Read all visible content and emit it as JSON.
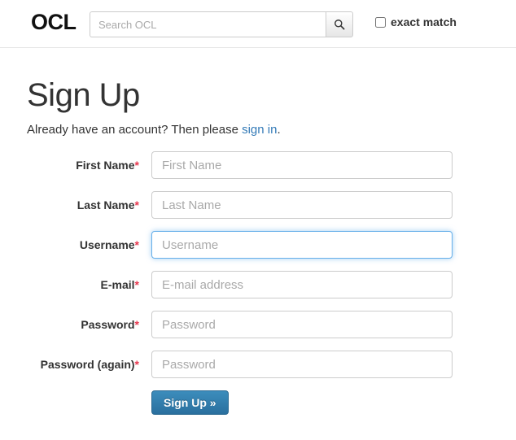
{
  "header": {
    "brand": "OCL",
    "search": {
      "placeholder": "Search OCL",
      "value": "",
      "button_icon": "search-icon"
    },
    "exact_match": {
      "label": "exact match",
      "checked": false
    }
  },
  "page": {
    "title": "Sign Up",
    "subtitle_prefix": "Already have an account? Then please ",
    "subtitle_link": "sign in",
    "subtitle_suffix": "."
  },
  "form": {
    "required_marker": "*",
    "fields": [
      {
        "label": "First Name",
        "required": true,
        "placeholder": "First Name",
        "value": "",
        "type": "text",
        "focused": false
      },
      {
        "label": "Last Name",
        "required": true,
        "placeholder": "Last Name",
        "value": "",
        "type": "text",
        "focused": false
      },
      {
        "label": "Username",
        "required": true,
        "placeholder": "Username",
        "value": "",
        "type": "text",
        "focused": true
      },
      {
        "label": "E-mail",
        "required": true,
        "placeholder": "E-mail address",
        "value": "",
        "type": "email",
        "focused": false
      },
      {
        "label": "Password",
        "required": true,
        "placeholder": "Password",
        "value": "",
        "type": "password",
        "focused": false
      },
      {
        "label": "Password (again)",
        "required": true,
        "placeholder": "Password",
        "value": "",
        "type": "password",
        "focused": false
      }
    ],
    "submit_label": "Sign Up »"
  },
  "colors": {
    "link": "#337ab7",
    "required": "#e8384f",
    "focus_border": "#66afe9",
    "button_top": "#3c8dbc",
    "button_bottom": "#2a6f9e"
  }
}
